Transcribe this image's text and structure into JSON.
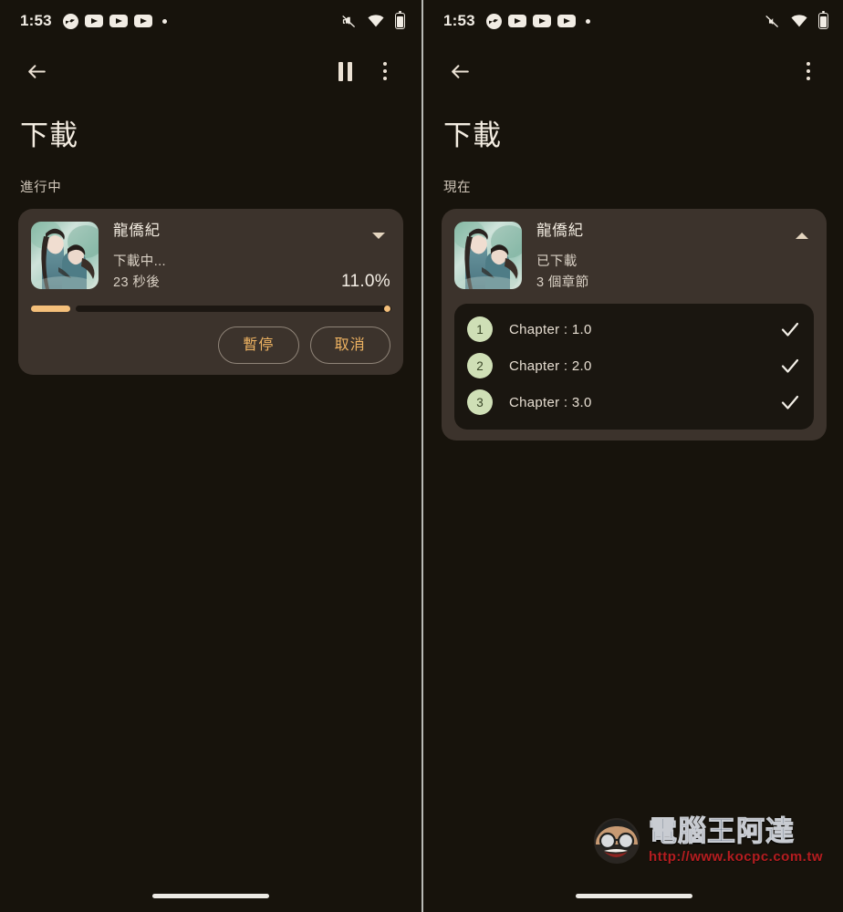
{
  "status_bar": {
    "time": "1:53",
    "left_icons": [
      "messenger-icon",
      "youtube-icon",
      "youtube-icon",
      "youtube-icon",
      "dot-icon"
    ],
    "right_icons": [
      "mute-icon",
      "wifi-icon",
      "battery-icon"
    ]
  },
  "colors": {
    "background": "#17130c",
    "card": "#3c332c",
    "accent": "#f0b462",
    "progress": "#f4bf7a",
    "chip": "#cfdfb6",
    "chip_text": "#384426",
    "text_primary": "#f0e9de",
    "text_secondary": "#d9d0c4",
    "divider": "#b9bab6"
  },
  "left_panel": {
    "appbar": {
      "back_label": "back-arrow",
      "pause_label": "pause",
      "menu_label": "more-options"
    },
    "page_title": "下載",
    "section_label": "進行中",
    "card": {
      "title": "龍僑紀",
      "status": "下載中...",
      "eta": "23 秒後",
      "percent": "11.0%",
      "percent_value": 11.0,
      "expand_state": "collapsed",
      "buttons": [
        {
          "label": "暫停",
          "name": "pause-button"
        },
        {
          "label": "取消",
          "name": "cancel-button"
        }
      ]
    }
  },
  "right_panel": {
    "appbar": {
      "back_label": "back-arrow",
      "menu_label": "more-options"
    },
    "page_title": "下載",
    "section_label": "現在",
    "card": {
      "title": "龍僑紀",
      "status": "已下載",
      "count": "3 個章節",
      "expand_state": "expanded",
      "chapters": [
        {
          "number": "1",
          "name": "Chapter : 1.0",
          "state": "done"
        },
        {
          "number": "2",
          "name": "Chapter : 2.0",
          "state": "done"
        },
        {
          "number": "3",
          "name": "Chapter : 3.0",
          "state": "done"
        }
      ]
    }
  },
  "watermark": {
    "title": "電腦王阿達",
    "url": "http://www.kocpc.com.tw"
  }
}
